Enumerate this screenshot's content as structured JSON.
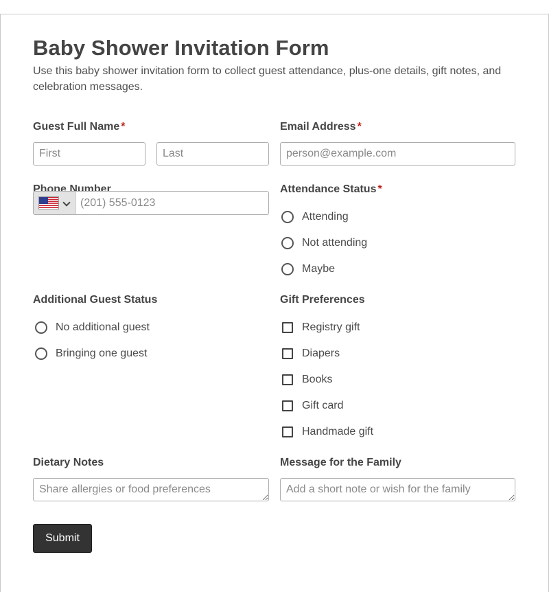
{
  "form": {
    "title": "Baby Shower Invitation Form",
    "description": "Use this baby shower invitation form to collect guest attendance, plus-one details, gift notes, and celebration messages.",
    "required_mark": "*"
  },
  "guest_name": {
    "label": "Guest Full Name",
    "first_placeholder": "First",
    "last_placeholder": "Last"
  },
  "email": {
    "label": "Email Address",
    "placeholder": "person@example.com"
  },
  "phone": {
    "label": "Phone Number",
    "country_flag": "us-flag-icon",
    "placeholder": "(201) 555-0123"
  },
  "attendance": {
    "label": "Attendance Status",
    "options": [
      "Attending",
      "Not attending",
      "Maybe"
    ]
  },
  "additional_guest": {
    "label": "Additional Guest Status",
    "options": [
      "No additional guest",
      "Bringing one guest"
    ]
  },
  "gifts": {
    "label": "Gift Preferences",
    "options": [
      "Registry gift",
      "Diapers",
      "Books",
      "Gift card",
      "Handmade gift"
    ]
  },
  "dietary": {
    "label": "Dietary Notes",
    "placeholder": "Share allergies or food preferences"
  },
  "message": {
    "label": "Message for the Family",
    "placeholder": "Add a short note or wish for the family"
  },
  "submit": {
    "label": "Submit"
  },
  "colors": {
    "required": "#c0221c",
    "button": "#333333",
    "border": "#adadad",
    "text": "#444444"
  }
}
